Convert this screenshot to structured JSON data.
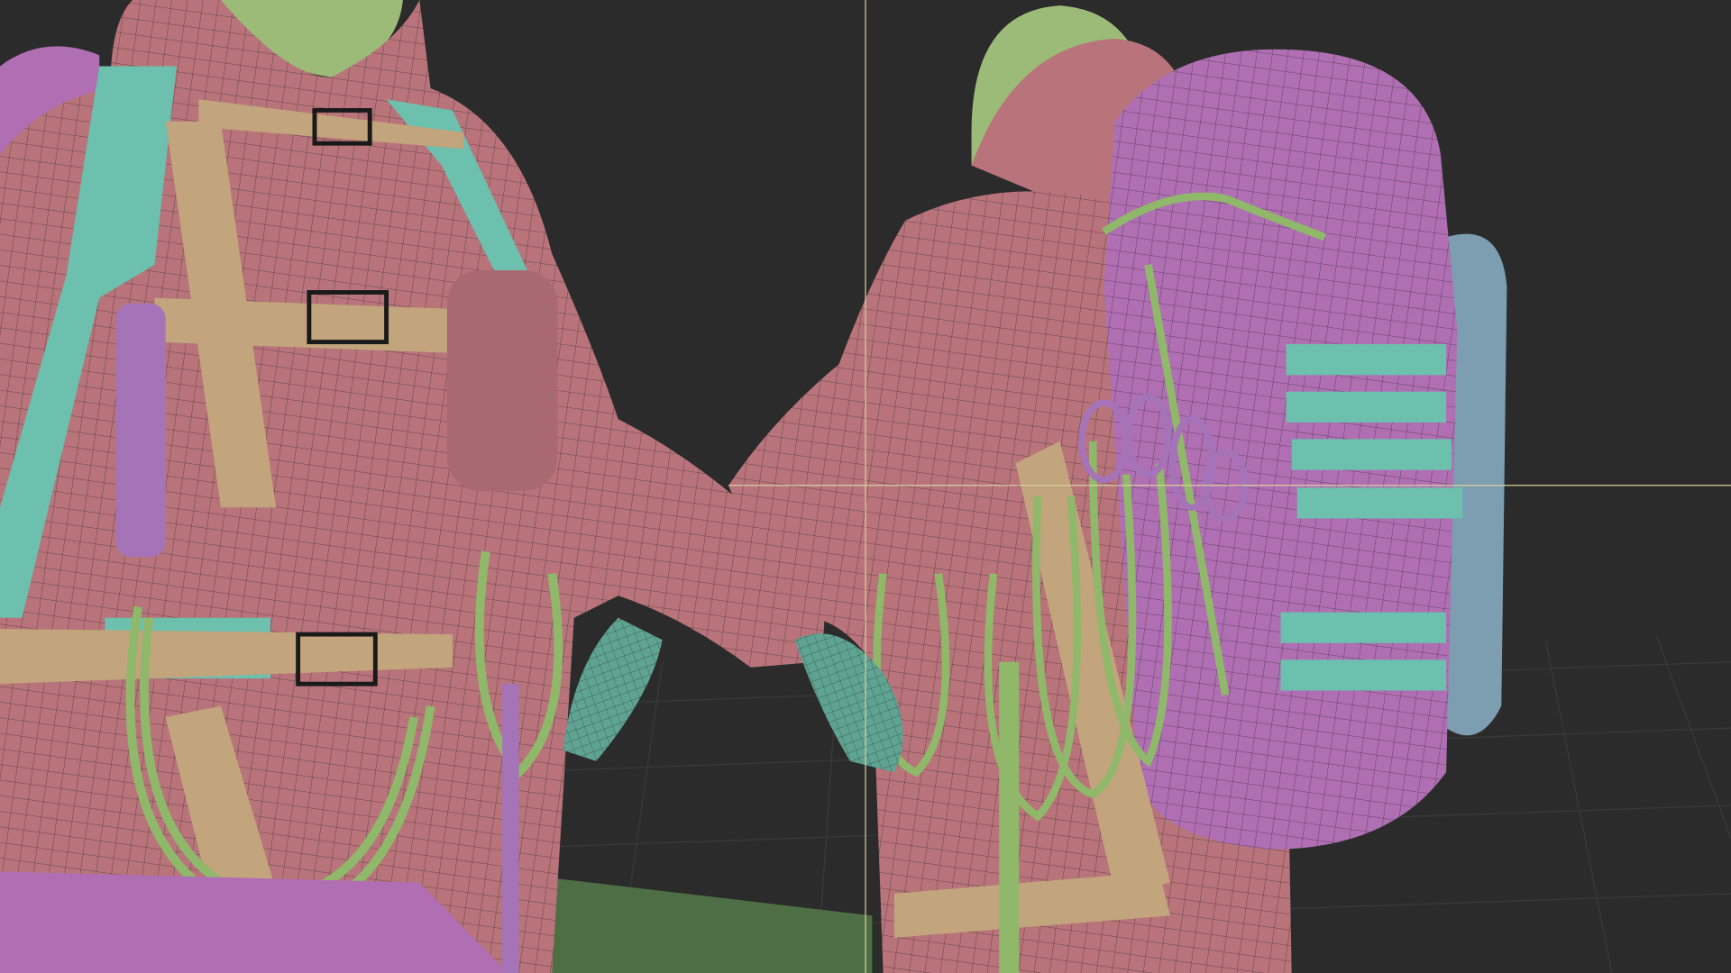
{
  "viewport": {
    "background_color": "#2b2b2b",
    "crosshair_color": "#d9cf9f",
    "floor_color": "#4e6f45",
    "materials": {
      "jacket": "#b8747a",
      "backpack": "#b06fb3",
      "hood": "#9dbb78",
      "strap_teal": "#6dbfae",
      "strap_tan": "#c2a47d",
      "rope": "#90b86a",
      "pocket_blue": "#7d9db1",
      "glove": "#5fa493"
    }
  }
}
